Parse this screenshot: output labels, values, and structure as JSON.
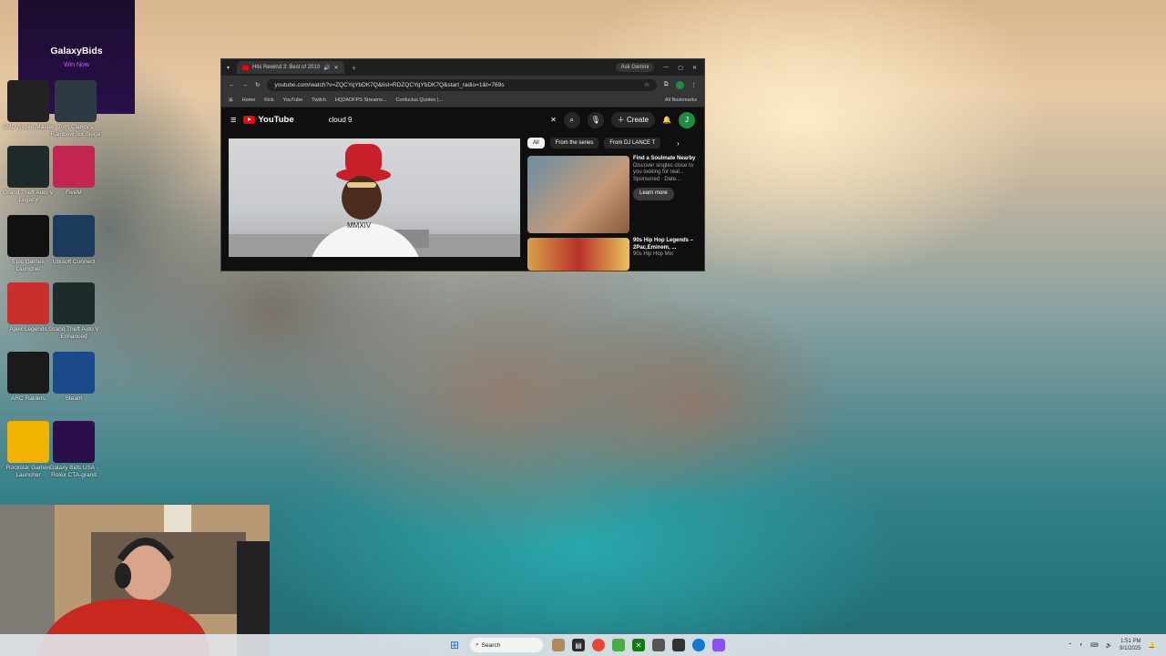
{
  "desktop_icons": [
    {
      "label": "AMD Ryzen Master",
      "icon": "amd-icon",
      "color": "#222222"
    },
    {
      "label": "Tom Clancy's Rainbow Six Siege",
      "icon": "r6-icon",
      "color": "#2d3a44"
    },
    {
      "label": "Grand Theft Auto V Legacy",
      "icon": "gta-icon",
      "color": "#1f2a2a"
    },
    {
      "label": "FiveM",
      "icon": "fivem-icon",
      "color": "#c22650"
    },
    {
      "label": "Epic Games Launcher",
      "icon": "epic-icon",
      "color": "#111111"
    },
    {
      "label": "Ubisoft Connect",
      "icon": "ubisoft-icon",
      "color": "#1b3a5c"
    },
    {
      "label": "Apex Legends",
      "icon": "apex-icon",
      "color": "#c9302c"
    },
    {
      "label": "Grand Theft Auto V Enhanced",
      "icon": "gta-icon",
      "color": "#1f2a2a"
    },
    {
      "label": "ARC Raiders",
      "icon": "arc-icon",
      "color": "#1a1a1a"
    },
    {
      "label": "Steam",
      "icon": "steam-icon",
      "color": "#1b4a8a"
    },
    {
      "label": "Rockstar Games Launcher",
      "icon": "rockstar-icon",
      "color": "#f2b300"
    },
    {
      "label": "Galaxy Bids USA - Rolex CTA-grand",
      "icon": "galaxybids-icon",
      "color": "#2a0f4a"
    }
  ],
  "ad_widget": {
    "brand": "GalaxyBids",
    "tagline": "Win Now"
  },
  "browser": {
    "tab_title": "Hits Rewind 3: Best of 2010",
    "ask_gemini": "Ask Gemini",
    "url": "youtube.com/watch?v=ZQCYqYbDK7Q&list=RDZQCYqYbDK7Q&start_radio=1&t=769s",
    "bookmarks": [
      "Home",
      "Kick",
      "YouTube",
      "Twitch",
      "HQ2AOFPS Streams...",
      "Confucius Quotes (..."
    ],
    "all_bookmarks": "All Bookmarks",
    "youtube": {
      "logo_text": "YouTube",
      "search_value": "cloud 9",
      "create_label": "Create",
      "avatar_letter": "J",
      "chips": [
        "All",
        "From the series",
        "From DJ LANCE T"
      ],
      "cards": [
        {
          "title": "Find a Soulmate Nearby",
          "desc": "Discover singles close to you looking for real...",
          "sponsored": "Sponsored · Date...",
          "button": "Learn more"
        },
        {
          "title": "90s Hip Hop Legends – 2Pac,Eminem, ...",
          "desc": "90s Hip Hop Mix"
        }
      ]
    }
  },
  "taskbar": {
    "search_placeholder": "Search",
    "time": "1:51 PM",
    "date": "9/1/2025"
  },
  "colors": {
    "youtube_red": "#ff0000",
    "accent": "#c85bff"
  }
}
